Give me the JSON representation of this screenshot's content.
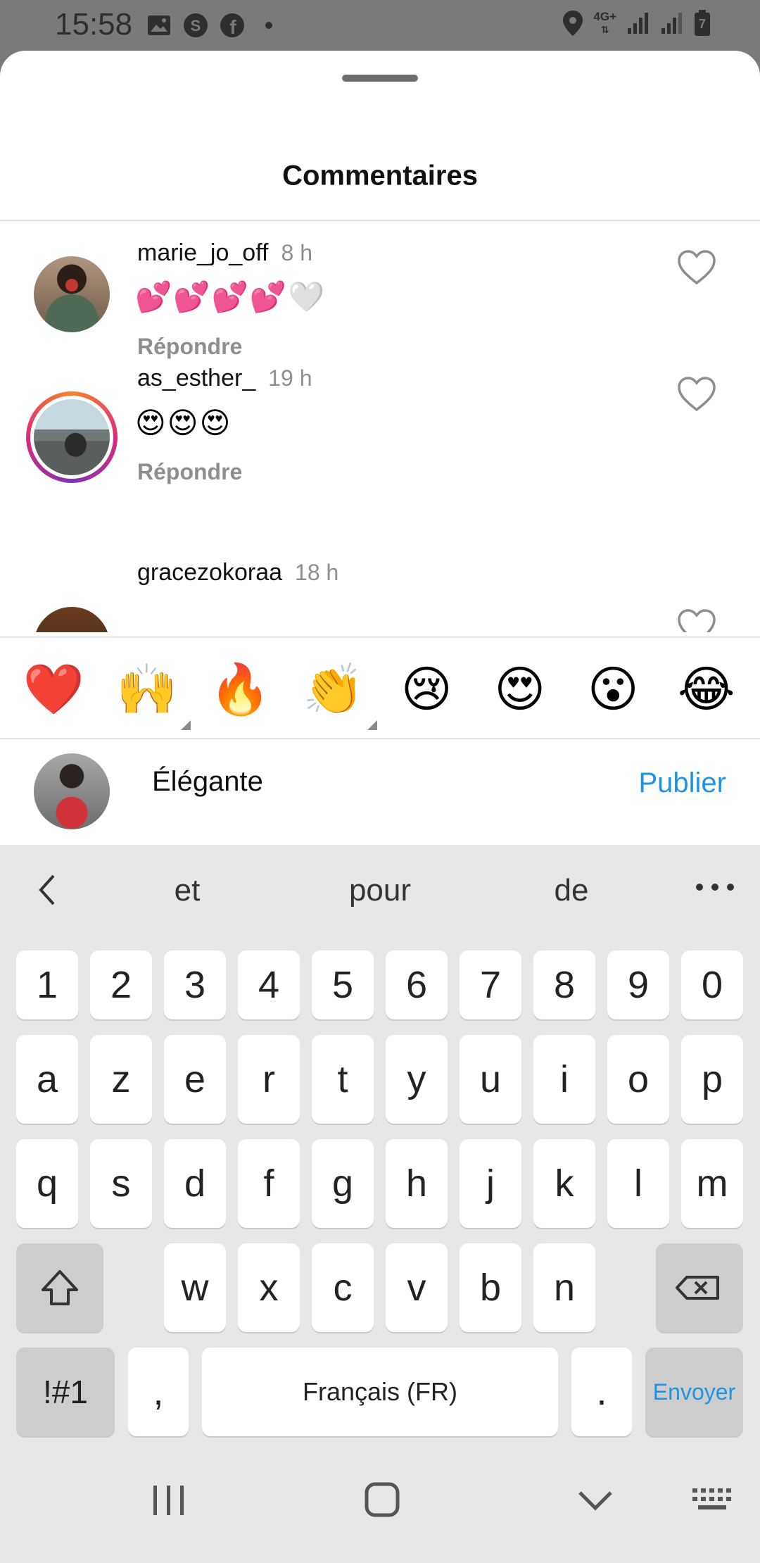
{
  "status_bar": {
    "time": "15:58",
    "left_icons": [
      "image-icon",
      "s-app-icon",
      "facebook-icon",
      "dot-icon"
    ],
    "network": "4G+",
    "battery_level": "7"
  },
  "sheet": {
    "title": "Commentaires"
  },
  "comments": [
    {
      "username": "marie_jo_off",
      "time": "8 h",
      "text": "💕💕💕💕🤍",
      "reply": "Répondre"
    },
    {
      "username": "as_esther_",
      "time": "19 h",
      "text": "😍😍😍",
      "reply": "Répondre"
    },
    {
      "username": "gracezokoraa",
      "time": "18 h",
      "text": "",
      "reply": ""
    }
  ],
  "reactions": [
    "❤️",
    "🙌",
    "🔥",
    "👏",
    "😢",
    "😍",
    "😮",
    "😂"
  ],
  "composer": {
    "input_value": "Élégante",
    "publish_label": "Publier"
  },
  "keyboard": {
    "suggestions": [
      "et",
      "pour",
      "de"
    ],
    "row_numbers": [
      "1",
      "2",
      "3",
      "4",
      "5",
      "6",
      "7",
      "8",
      "9",
      "0"
    ],
    "row1": [
      "a",
      "z",
      "e",
      "r",
      "t",
      "y",
      "u",
      "i",
      "o",
      "p"
    ],
    "row2": [
      "q",
      "s",
      "d",
      "f",
      "g",
      "h",
      "j",
      "k",
      "l",
      "m"
    ],
    "row3": [
      "w",
      "x",
      "c",
      "v",
      "b",
      "n"
    ],
    "symbols_label": "!#1",
    "comma": ",",
    "space_label": "Français (FR)",
    "period": ".",
    "send_label": "Envoyer"
  },
  "colors": {
    "accent_blue": "#1d93e3",
    "heart_red": "#e02d2d",
    "muted_gray": "#8e8e8e"
  }
}
